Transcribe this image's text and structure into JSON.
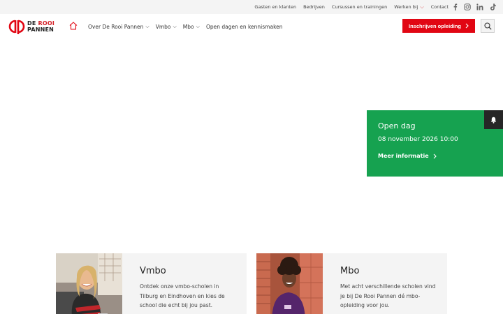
{
  "topbar": {
    "links": [
      {
        "label": "Gasten en klanten"
      },
      {
        "label": "Bedrijven"
      },
      {
        "label": "Cursussen en trainingen"
      },
      {
        "label": "Werken bij"
      },
      {
        "label": "Contact"
      }
    ],
    "social": [
      "facebook-icon",
      "instagram-icon",
      "linkedin-icon",
      "tiktok-icon"
    ]
  },
  "header": {
    "logo": {
      "line1_a": "DE ",
      "line1_b": "ROOI",
      "line2": "PANNEN"
    },
    "nav": [
      {
        "label": "Over De Rooi Pannen",
        "dropdown": true
      },
      {
        "label": "Vmbo",
        "dropdown": true
      },
      {
        "label": "Mbo",
        "dropdown": true
      },
      {
        "label": "Open dagen en kennismaken",
        "dropdown": false
      }
    ],
    "cta_label": "Inschrijven opleiding",
    "brand_color": "#e10613"
  },
  "openday": {
    "title": "Open dag",
    "date": "08 november 2026 10:00",
    "more_label": "Meer informatie",
    "color": "#16a250"
  },
  "cards": [
    {
      "title": "Vmbo",
      "desc": "Ontdek onze vmbo-scholen in Tilburg en Eindhoven en kies de school die echt bij jou past."
    },
    {
      "title": "Mbo",
      "desc": "Met acht verschillende scholen vind je bij De Rooi Pannen dé mbo-opleiding voor jou."
    }
  ]
}
